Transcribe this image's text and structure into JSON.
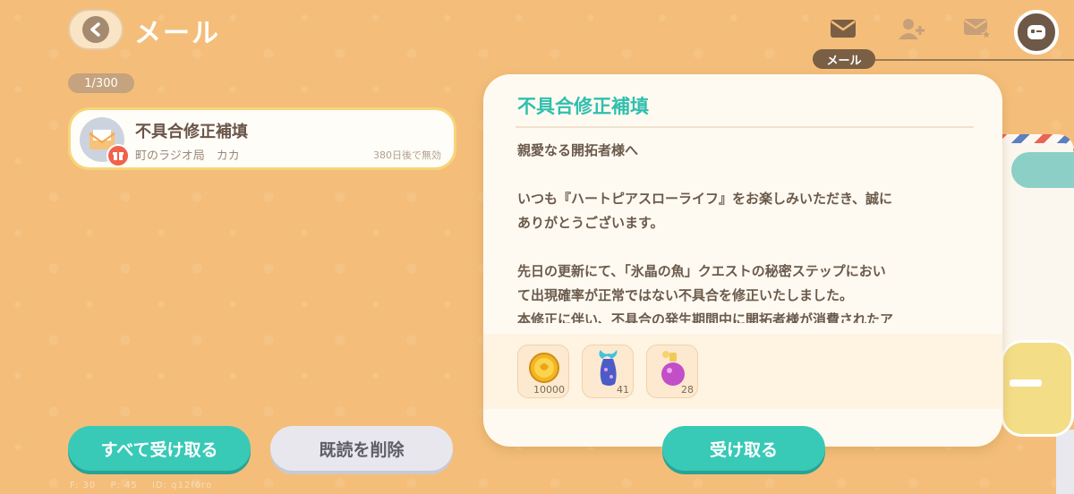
{
  "header": {
    "title": "メール",
    "active_tab_label": "メール"
  },
  "mail_list": {
    "counter": "1/300",
    "items": [
      {
        "subject": "不具合修正補填",
        "sender": "町のラジオ局　カカ",
        "expiry": "380日後で無効"
      }
    ]
  },
  "detail": {
    "title": "不具合修正補填",
    "body": {
      "greeting": "親愛なる開拓者様へ",
      "para1_line1": "いつも『ハートピアスローライフ』をお楽しみいただき、誠に",
      "para1_line2": "ありがとうございます。",
      "para2_line1": "先日の更新にて、「氷晶の魚」クエストの秘密ステップにおい",
      "para2_line2": "て出現確率が正常ではない不具合を修正いたしました。",
      "para2_line3": "本修正に伴い、不具合の発生期間中に開拓者様が消費されたア"
    },
    "rewards": [
      {
        "icon": "gold-coin-icon",
        "qty": "10000"
      },
      {
        "icon": "mermaid-tail-icon",
        "qty": "41"
      },
      {
        "icon": "perfume-bottle-icon",
        "qty": "28"
      }
    ],
    "claim_label": "受け取る"
  },
  "actions": {
    "claim_all_label": "すべて受け取る",
    "delete_read_label": "既読を削除"
  },
  "footer": {
    "f": "F: 30",
    "p": "P: 45",
    "id": "ID: q12f6ro"
  },
  "colors": {
    "background": "#f4be7a",
    "accent_teal": "#39c9b7",
    "title_teal": "#30bfae",
    "badge_red": "#f0624b"
  }
}
